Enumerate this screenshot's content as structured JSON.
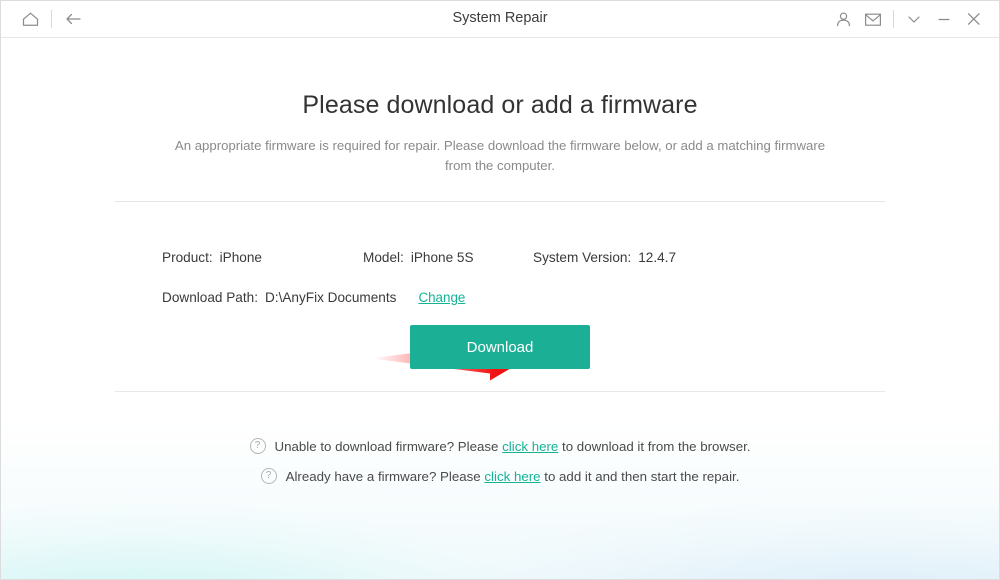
{
  "window": {
    "title": "System Repair",
    "accent_color": "#1bb096",
    "link_color": "#14b396",
    "arrow_color": "#ee1111"
  },
  "titlebar": {
    "home_icon": "home-icon",
    "back_icon": "back-arrow-icon",
    "account_icon": "person-icon",
    "mail_icon": "envelope-icon",
    "more_icon": "chevron-down-icon",
    "minimize_icon": "minimize-icon",
    "close_icon": "close-icon"
  },
  "main": {
    "headline": "Please download or add a firmware",
    "subhead": "An appropriate firmware is required for repair. Please download the firmware below, or add a matching firmware from the computer."
  },
  "device_info": {
    "product_label": "Product:",
    "product_value": "iPhone",
    "model_label": "Model:",
    "model_value": "iPhone 5S",
    "version_label": "System Version:",
    "version_value": "12.4.7",
    "path_label": "Download Path:",
    "path_value": "D:\\AnyFix Documents",
    "change_link": "Change"
  },
  "actions": {
    "download_button": "Download"
  },
  "help": [
    {
      "icon": "question-circle-icon",
      "prefix": "Unable to download firmware? Please ",
      "link": "click here",
      "suffix": " to download it from the browser."
    },
    {
      "icon": "question-circle-icon",
      "prefix": "Already have a firmware? Please ",
      "link": "click here",
      "suffix": " to add it and then start the repair."
    }
  ]
}
